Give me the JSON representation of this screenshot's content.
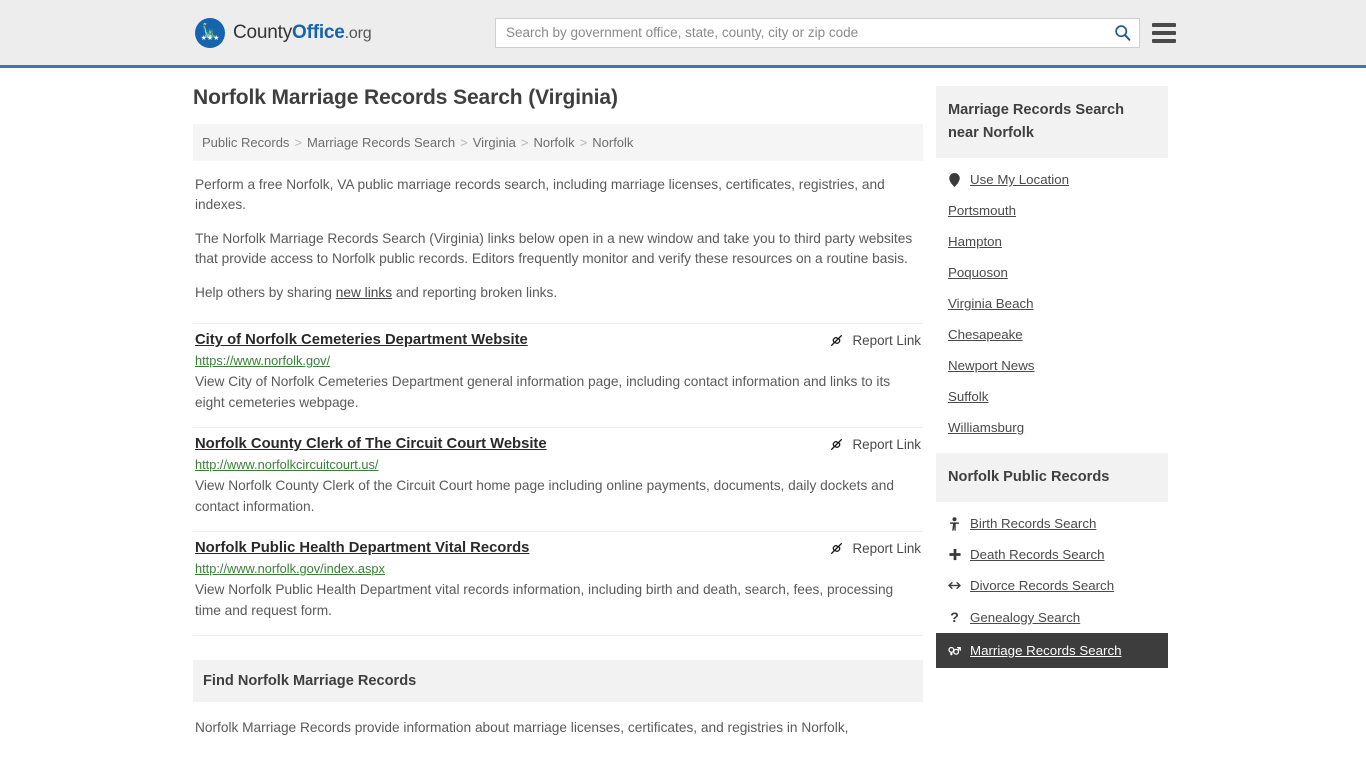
{
  "header": {
    "brand": {
      "part1": "County",
      "part2": "Office",
      "part3": ".org",
      "seal_icon": "eagle-seal-icon"
    },
    "search": {
      "placeholder": "Search by government office, state, county, city or zip code",
      "value": "",
      "button_icon": "search-icon"
    },
    "menu_icon": "hamburger-menu-icon",
    "accent_color": "#3a78b0",
    "background_color": "#ededed"
  },
  "main": {
    "title": "Norfolk Marriage Records Search (Virginia)",
    "breadcrumb": {
      "separator": ">",
      "items": [
        {
          "label": "Public Records"
        },
        {
          "label": "Marriage Records Search"
        },
        {
          "label": "Virginia"
        },
        {
          "label": "Norfolk"
        },
        {
          "label": "Norfolk"
        }
      ]
    },
    "intro": {
      "p1": "Perform a free Norfolk, VA public marriage records search, including marriage licenses, certificates, registries, and indexes.",
      "p2": "The Norfolk Marriage Records Search (Virginia) links below open in a new window and take you to third party websites that provide access to Norfolk public records. Editors frequently monitor and verify these resources on a routine basis.",
      "p3_before": "Help others by sharing ",
      "p3_link": "new links",
      "p3_after": " and reporting broken links."
    },
    "report_link_label": "Report Link",
    "report_link_icon": "broken-link-icon",
    "results": [
      {
        "title": "City of Norfolk Cemeteries Department Website",
        "url": "https://www.norfolk.gov/",
        "description": "View City of Norfolk Cemeteries Department general information page, including contact information and links to its eight cemeteries webpage."
      },
      {
        "title": "Norfolk County Clerk of The Circuit Court Website",
        "url": "http://www.norfolkcircuitcourt.us/",
        "description": "View Norfolk County Clerk of the Circuit Court home page including online payments, documents, daily dockets and contact information."
      },
      {
        "title": "Norfolk Public Health Department Vital Records",
        "url": "http://www.norfolk.gov/index.aspx",
        "description": "View Norfolk Public Health Department vital records information, including birth and death, search, fees, processing time and request form."
      }
    ],
    "bottom_section": {
      "heading": "Find Norfolk Marriage Records",
      "body": "Norfolk Marriage Records provide information about marriage licenses, certificates, and registries in Norfolk,"
    },
    "url_color": "#3c7d3c"
  },
  "sidebar": {
    "nearby": {
      "heading": "Marriage Records Search near Norfolk",
      "items": [
        {
          "label": "Use My Location",
          "icon": "map-pin-icon"
        },
        {
          "label": "Portsmouth",
          "icon": ""
        },
        {
          "label": "Hampton",
          "icon": ""
        },
        {
          "label": "Poquoson",
          "icon": ""
        },
        {
          "label": "Virginia Beach",
          "icon": ""
        },
        {
          "label": "Chesapeake",
          "icon": ""
        },
        {
          "label": "Newport News",
          "icon": ""
        },
        {
          "label": "Suffolk",
          "icon": ""
        },
        {
          "label": "Williamsburg",
          "icon": ""
        }
      ]
    },
    "public_records": {
      "heading": "Norfolk Public Records",
      "items": [
        {
          "label": "Birth Records Search",
          "icon": "baby-icon",
          "glyph": "Ɣ",
          "active": false
        },
        {
          "label": "Death Records Search",
          "icon": "cross-icon",
          "glyph": "✚",
          "active": false
        },
        {
          "label": "Divorce Records Search",
          "icon": "double-arrow-icon",
          "glyph": "↔",
          "active": false
        },
        {
          "label": "Genealogy Search",
          "icon": "question-mark-icon",
          "glyph": "?",
          "active": false
        },
        {
          "label": "Marriage Records Search",
          "icon": "gender-symbols-icon",
          "glyph": "⚤",
          "active": true
        }
      ],
      "active_bg": "#3d3d3d"
    }
  }
}
